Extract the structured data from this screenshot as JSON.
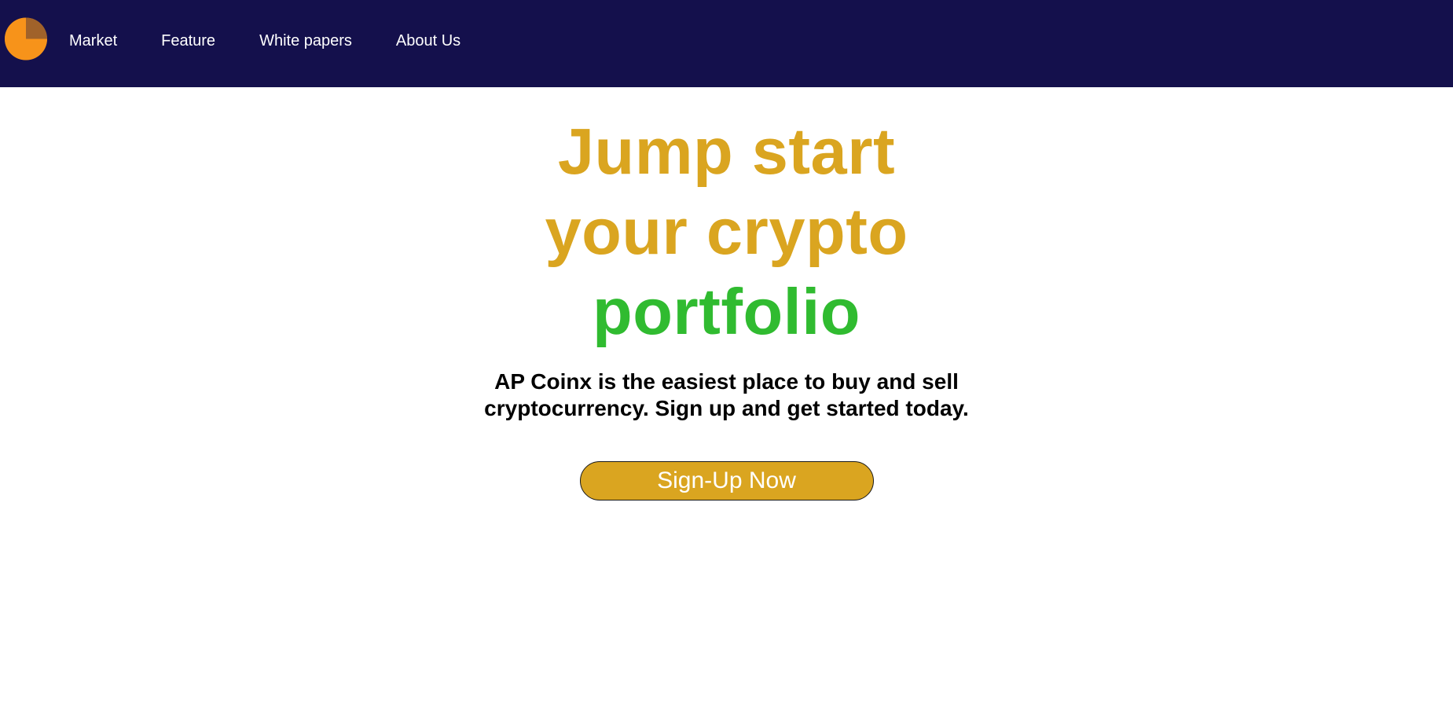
{
  "colors": {
    "nav_background": "#14104c",
    "headline_gold": "#daa520",
    "headline_green": "#30bb30",
    "button_background": "#daa520",
    "logo_primary": "#f7931a",
    "logo_secondary": "#a0622a"
  },
  "navbar": {
    "logo_icon": "coin-logo-icon",
    "links": [
      {
        "label": "Market"
      },
      {
        "label": "Feature"
      },
      {
        "label": "White papers"
      },
      {
        "label": "About Us"
      }
    ]
  },
  "hero": {
    "headline_line1": "Jump start",
    "headline_line2": "your crypto",
    "headline_line3": "portfolio",
    "subtitle": "AP Coinx is the easiest place to buy and sell cryptocurrency. Sign up and get started today.",
    "cta_label": "Sign-Up Now"
  }
}
